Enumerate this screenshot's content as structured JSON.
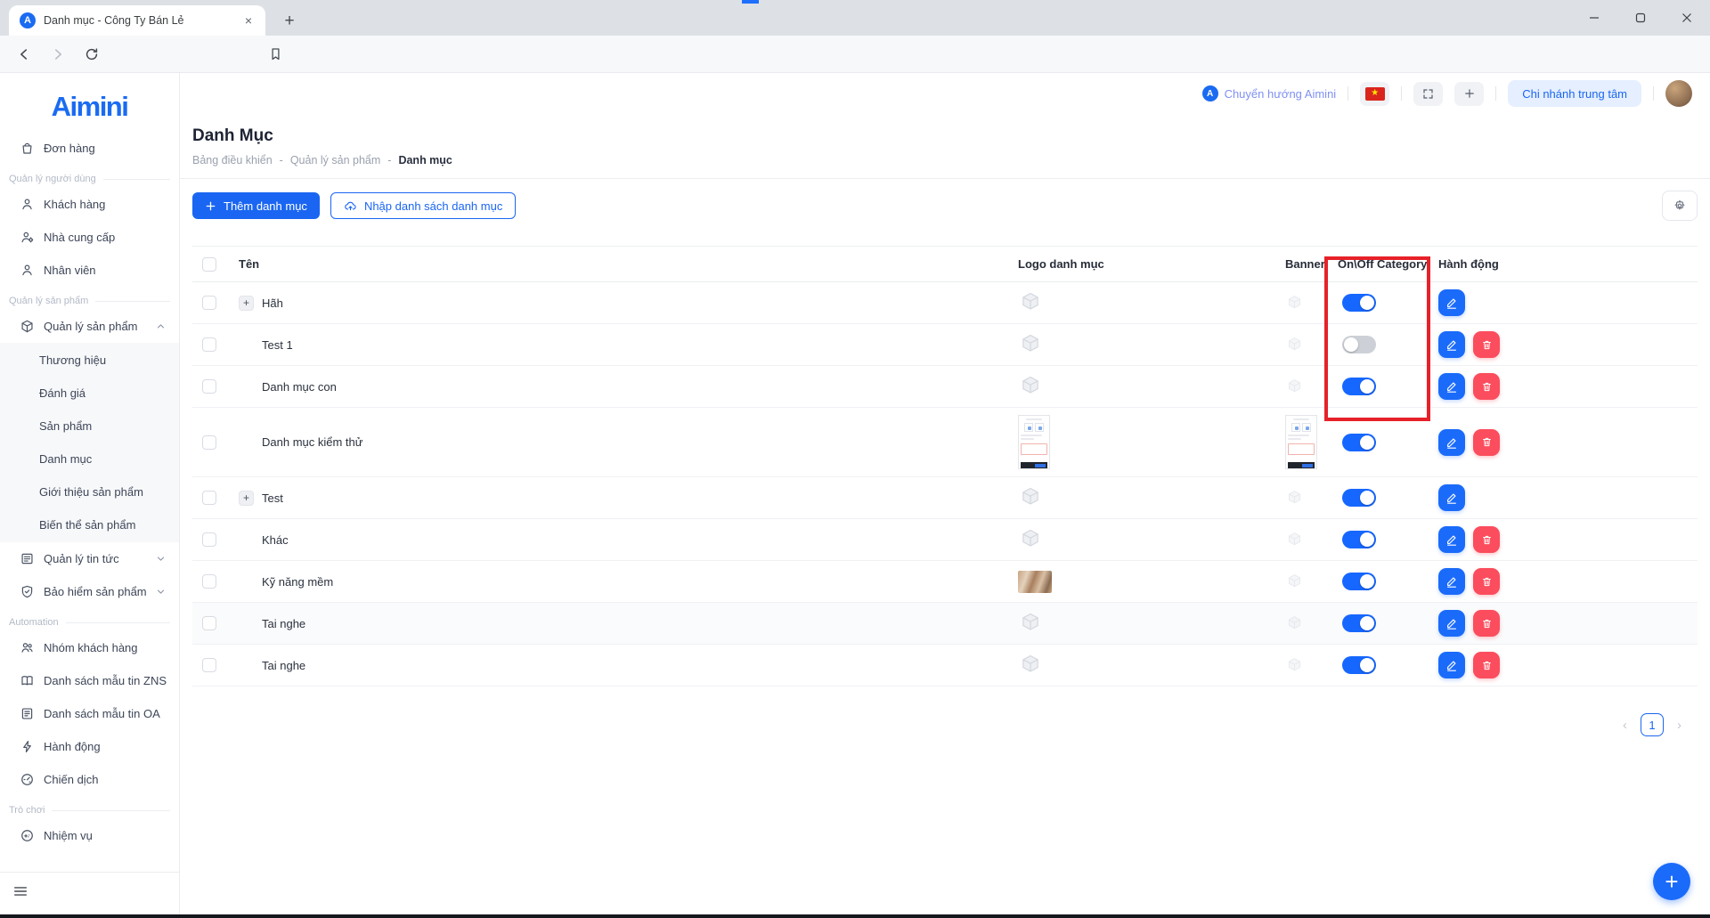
{
  "browser": {
    "tab_title": "Danh mục - Công Ty Bán Lẻ",
    "favicon_letter": "A",
    "url": "admin.aimini.vn/admin/custom-collection"
  },
  "topbar": {
    "redirect_badge": "A",
    "redirect_label": "Chuyển hướng Aimini",
    "branch_button_label": "Chi nhánh trung tâm"
  },
  "sidebar": {
    "logo_text": "Aimini",
    "items": [
      {
        "type": "item",
        "label": "Đơn hàng",
        "icon": "bag-icon"
      },
      {
        "type": "section",
        "label": "Quản lý người dùng"
      },
      {
        "type": "item",
        "label": "Khách hàng",
        "icon": "user-icon"
      },
      {
        "type": "item",
        "label": "Nhà cung cấp",
        "icon": "user-gear-icon"
      },
      {
        "type": "item",
        "label": "Nhân viên",
        "icon": "user-icon"
      },
      {
        "type": "section",
        "label": "Quản lý sản phẩm"
      },
      {
        "type": "item",
        "label": "Quản lý sản phẩm",
        "icon": "box-icon",
        "chevron": "up"
      },
      {
        "type": "subgroup",
        "children": [
          "Thương hiệu",
          "Đánh giá",
          "Sản phẩm",
          "Danh mục",
          "Giới thiệu sản phẩm",
          "Biến thể sản phẩm"
        ]
      },
      {
        "type": "item",
        "label": "Quản lý tin tức",
        "icon": "news-icon",
        "chevron": "down"
      },
      {
        "type": "item",
        "label": "Bảo hiểm sản phẩm",
        "icon": "shield-check-icon",
        "chevron": "down"
      },
      {
        "type": "section",
        "label": "Automation"
      },
      {
        "type": "item",
        "label": "Nhóm khách hàng",
        "icon": "users-icon"
      },
      {
        "type": "item",
        "label": "Danh sách mẫu tin ZNS",
        "icon": "book-icon"
      },
      {
        "type": "item",
        "label": "Danh sách mẫu tin OA",
        "icon": "list-icon"
      },
      {
        "type": "item",
        "label": "Hành động",
        "icon": "zap-icon"
      },
      {
        "type": "item",
        "label": "Chiến dịch",
        "icon": "gauge-icon"
      },
      {
        "type": "section",
        "label": "Trò chơi"
      },
      {
        "type": "item",
        "label": "Nhiệm vụ",
        "icon": "game-icon"
      }
    ]
  },
  "page": {
    "title": "Danh Mục",
    "breadcrumb": [
      "Bảng điều khiển",
      "Quản lý sản phẩm",
      "Danh mục"
    ],
    "breadcrumb_separator": "-",
    "add_button_label": "Thêm danh mục",
    "import_button_label": "Nhập danh sách danh mục"
  },
  "table": {
    "headers": {
      "name": "Tên",
      "logo": "Logo danh mục",
      "banner": "Banner",
      "toggle": "On\\Off Category",
      "actions": "Hành động"
    },
    "rows": [
      {
        "name": "Hãh",
        "expandable": true,
        "logo": "cube",
        "banner": "cube",
        "enabled": true,
        "actions": [
          "edit"
        ]
      },
      {
        "name": "Test 1",
        "expandable": false,
        "logo": "cube",
        "banner": "cube",
        "enabled": false,
        "actions": [
          "edit",
          "delete"
        ]
      },
      {
        "name": "Danh mục con",
        "expandable": false,
        "logo": "cube",
        "banner": "cube",
        "enabled": true,
        "actions": [
          "edit",
          "delete"
        ]
      },
      {
        "name": "Danh mục kiểm thử",
        "expandable": false,
        "logo": "screenshot",
        "banner": "screenshot",
        "enabled": true,
        "actions": [
          "edit",
          "delete"
        ],
        "tall": true
      },
      {
        "name": "Test",
        "expandable": true,
        "logo": "cube",
        "banner": "cube",
        "enabled": true,
        "actions": [
          "edit"
        ]
      },
      {
        "name": "Khác",
        "expandable": false,
        "logo": "cube",
        "banner": "cube",
        "enabled": true,
        "actions": [
          "edit",
          "delete"
        ]
      },
      {
        "name": "Kỹ năng mềm",
        "expandable": false,
        "logo": "photo",
        "banner": "cube",
        "enabled": true,
        "actions": [
          "edit",
          "delete"
        ]
      },
      {
        "name": "Tai nghe",
        "expandable": false,
        "logo": "cube",
        "banner": "cube",
        "enabled": true,
        "actions": [
          "edit",
          "delete"
        ],
        "striped": true
      },
      {
        "name": "Tai nghe",
        "expandable": false,
        "logo": "cube",
        "banner": "cube",
        "enabled": true,
        "actions": [
          "edit",
          "delete"
        ]
      }
    ]
  },
  "pagination": {
    "current_page": "1"
  },
  "colors": {
    "primary_blue": "#1a66f2",
    "toggle_on": "#1667ff",
    "toggle_off": "#cdd1d7",
    "delete_red": "#fb4d5d",
    "highlight_box_red": "#e62129",
    "flag_red": "#da251d",
    "branch_button_bg": "#e5efff",
    "redirect_link": "#7f90f2"
  }
}
